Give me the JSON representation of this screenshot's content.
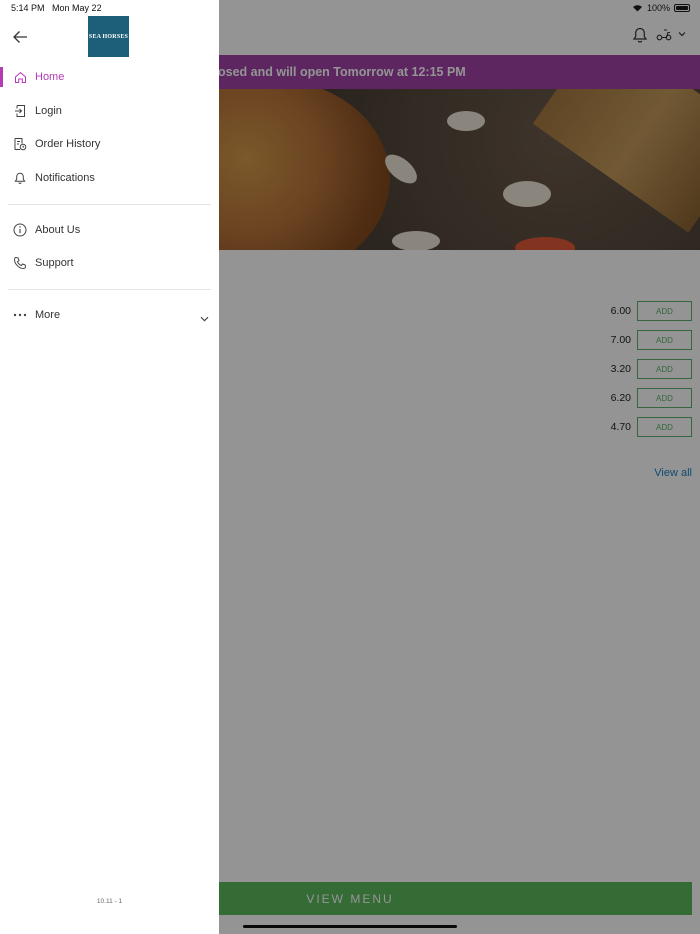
{
  "status": {
    "time": "5:14 PM",
    "date": "Mon May 22",
    "battery": "100%"
  },
  "banner": {
    "text": "osed and will open Tomorrow at 12:15 PM"
  },
  "items": [
    {
      "price": "6.00",
      "add_label": "ADD"
    },
    {
      "price": "7.00",
      "add_label": "ADD"
    },
    {
      "price": "3.20",
      "add_label": "ADD"
    },
    {
      "price": "6.20",
      "add_label": "ADD"
    },
    {
      "price": "4.70",
      "add_label": "ADD"
    }
  ],
  "view_all": "View all",
  "view_menu": "VIEW MENU",
  "drawer": {
    "logo_text": "SEA HORSES",
    "menu": [
      {
        "label": "Home",
        "icon": "home-icon",
        "active": true
      },
      {
        "label": "Login",
        "icon": "login-icon"
      },
      {
        "label": "Order History",
        "icon": "order-history-icon"
      },
      {
        "label": "Notifications",
        "icon": "bell-icon"
      }
    ],
    "menu2": [
      {
        "label": "About Us",
        "icon": "info-icon"
      },
      {
        "label": "Support",
        "icon": "phone-icon"
      }
    ],
    "more": {
      "label": "More",
      "icon": "more-dots-icon"
    },
    "version": "10.11 - 1"
  },
  "colors": {
    "accent": "#b43bb4",
    "banner": "#a042a8",
    "green": "#5cb85c",
    "link": "#1a7fc4"
  }
}
